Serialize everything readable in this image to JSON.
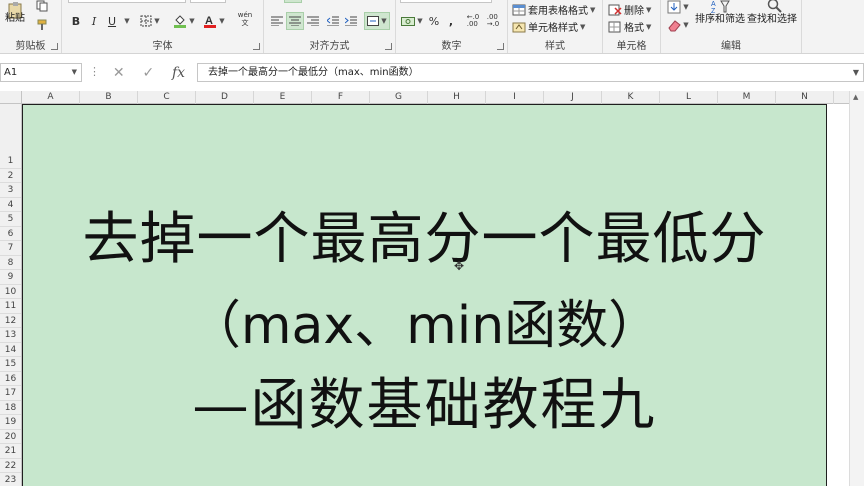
{
  "ribbon": {
    "groups": {
      "clipboard": "剪贴板",
      "font": "字体",
      "alignment": "对齐方式",
      "number": "数字",
      "styles": "样式",
      "cells": "单元格",
      "editing": "编辑"
    },
    "paste_label": "粘贴",
    "bold": "B",
    "italic": "I",
    "underline": "U",
    "phonetic": "wén",
    "percent": "%",
    "comma": ",",
    "table_format": "套用表格格式",
    "cell_style": "单元格样式",
    "delete": "删除",
    "format": "格式",
    "sort_filter": "排序和筛选",
    "find_select": "查找和选择"
  },
  "formula_bar": {
    "name_box": "A1",
    "fx": "fx",
    "content": "去掉一个最高分一个最低分（max、min函数）"
  },
  "grid": {
    "columns": [
      "A",
      "B",
      "C",
      "D",
      "E",
      "F",
      "G",
      "H",
      "I",
      "J",
      "K",
      "L",
      "M",
      "N"
    ],
    "rows": [
      "1",
      "2",
      "3",
      "4",
      "5",
      "6",
      "7",
      "8",
      "9",
      "10",
      "11",
      "12",
      "13",
      "14",
      "15",
      "16",
      "17",
      "18",
      "19",
      "20",
      "21",
      "22",
      "23"
    ]
  },
  "title": {
    "line1": "去掉一个最高分一个最低分",
    "line2": "（max、min函数）",
    "line3": "—函数基础教程九"
  },
  "colors": {
    "sheet_fill": "#c7e7cd",
    "ribbon_bg": "#f3f3f3",
    "selected_toggle": "#cfe6cf"
  }
}
